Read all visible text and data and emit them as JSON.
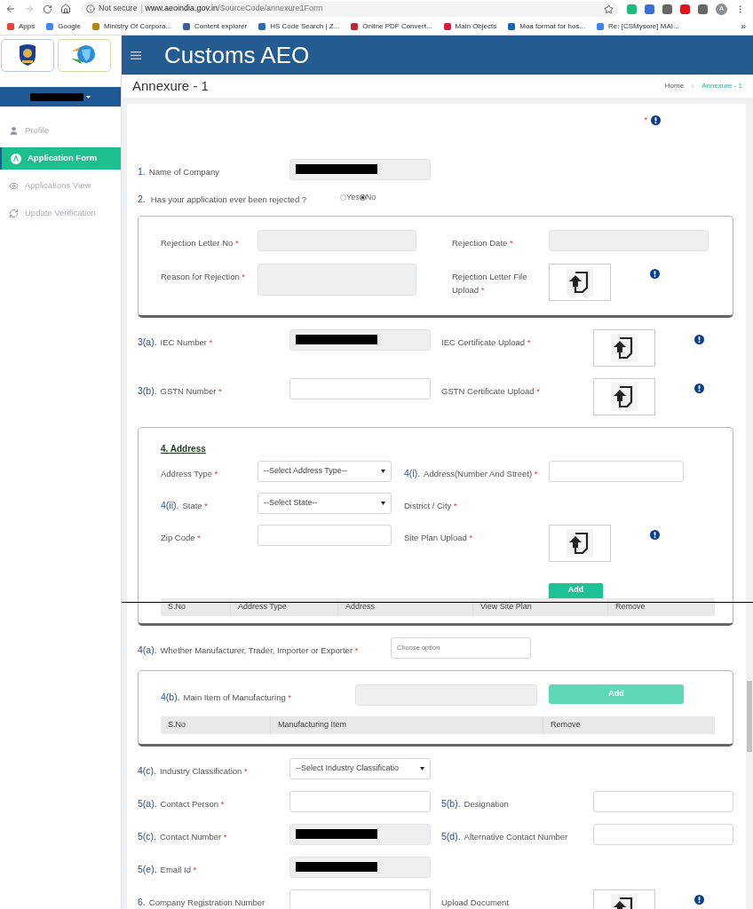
{
  "browser": {
    "security": "Not secure",
    "url_host": "www.aeoindia.gov.in",
    "url_path": "/SourceCode/annexure1Form",
    "profile_initial": "A",
    "more": "»",
    "bookmarks": [
      {
        "label": "Apps",
        "color": "#ea4335"
      },
      {
        "label": "Google",
        "color": "#4285f4"
      },
      {
        "label": "Ministry Of Corpora...",
        "color": "#b8860b"
      },
      {
        "label": "Content explorer",
        "color": "#3b5ba5"
      },
      {
        "label": "HS Code Search | Z...",
        "color": "#2b6cb0"
      },
      {
        "label": "Online PDF Convert...",
        "color": "#c0262d"
      },
      {
        "label": "Main Objects",
        "color": "#d81b3c"
      },
      {
        "label": "Moa format for hos...",
        "color": "#1565c0"
      },
      {
        "label": "Re: [CSMysore] MAI...",
        "color": "#3b82f6"
      }
    ]
  },
  "header": {
    "title": "Customs AEO"
  },
  "sidebar": {
    "user_redacted": true,
    "items": [
      {
        "label": "Profile",
        "kind": "user",
        "selected": false
      },
      {
        "label": "Application Form",
        "kind": "badge",
        "selected": true
      },
      {
        "label": "Applications View",
        "kind": "eye",
        "selected": false
      },
      {
        "label": "Update Verification",
        "kind": "refresh",
        "selected": false
      }
    ]
  },
  "page": {
    "title": "Annexure - 1",
    "breadcrumb": [
      {
        "label": "Home",
        "selected": false
      },
      {
        "label": "Annexure - 1",
        "selected": true
      }
    ]
  },
  "form": {
    "legend": {
      "mark": "*"
    },
    "sections": [
      {
        "kind": "row",
        "cells": [
          {
            "number": "1.",
            "label": "Name of Company",
            "kind": "readonly",
            "redacted": true
          }
        ]
      },
      {
        "kind": "radio",
        "number": "2.",
        "label": "Has your application ever been rejected ?",
        "options": [
          {
            "label": "Yes",
            "selected": false
          },
          {
            "label": "No",
            "selected": true
          }
        ]
      },
      {
        "kind": "box",
        "rows": [
          [
            {
              "label": "Rejection Letter No",
              "mark": "*",
              "kind": "readonly"
            },
            {
              "label": "Rejection Date",
              "mark": "*",
              "kind": "readonly"
            }
          ],
          [
            {
              "label": "Reason for Rejection",
              "mark": "*",
              "kind": "textarea"
            },
            {
              "label": "Rejection Letter File Upload",
              "mark": "*",
              "kind": "upload",
              "info": true
            }
          ]
        ]
      },
      {
        "kind": "row",
        "cells": [
          {
            "number": "3(a).",
            "label": "IEC Number",
            "mark": "*",
            "kind": "readonly",
            "redacted": true
          },
          {
            "label": "IEC Certificate Upload",
            "mark": "*",
            "kind": "upload",
            "info": true
          }
        ]
      },
      {
        "kind": "row",
        "cells": [
          {
            "number": "3(b).",
            "label": "GSTN Number",
            "mark": "*",
            "kind": "text"
          },
          {
            "label": "GSTN Certificate Upload",
            "mark": "*",
            "kind": "upload",
            "info": true
          }
        ]
      },
      {
        "kind": "address",
        "title": "4. Address",
        "field_rows": [
          [
            {
              "label": "Address Type",
              "mark": "*",
              "kind": "select",
              "value": "--Select Address Type--"
            },
            {
              "number": "4(i).",
              "label": "Address(Number And Street)",
              "mark": "*",
              "kind": "text"
            }
          ],
          [
            {
              "number": "4(ii).",
              "label": "State",
              "mark": "*",
              "kind": "select",
              "value": "--Select State--"
            },
            {
              "label": "District / City",
              "mark": "*",
              "kind": "none"
            }
          ],
          [
            {
              "label": "Zip Code",
              "mark": "*",
              "kind": "text"
            },
            {
              "label": "Site Plan Upload",
              "mark": "*",
              "kind": "upload",
              "info": true
            }
          ]
        ],
        "button": "Add",
        "columns": [
          "S.No",
          "Address Type",
          "Address",
          "View Site Plan",
          "Remove"
        ]
      },
      {
        "kind": "wide",
        "cells": [
          {
            "number": "4(a).",
            "label": "Whether Manufacturer, Trader, Importer or Exporter",
            "mark": "*",
            "kind": "choice",
            "placeholder": "Choose option"
          }
        ]
      },
      {
        "kind": "items",
        "button": "Add",
        "field": {
          "number": "4(b).",
          "label": "Main Item of Manufacturing",
          "mark": "*",
          "kind": "readonly"
        },
        "columns": [
          "S.No",
          "Manufacturing Item",
          "Remove"
        ]
      },
      {
        "kind": "row",
        "cells": [
          {
            "number": "4(c).",
            "label": "Industry Classification",
            "mark": "*",
            "kind": "select",
            "value": "--Select Industry Classificatio"
          }
        ]
      },
      {
        "kind": "row",
        "cells": [
          {
            "number": "5(a).",
            "label": "Contact Person",
            "mark": "*",
            "kind": "text"
          },
          {
            "number": "5(b).",
            "label": "Designation",
            "kind": "text"
          }
        ]
      },
      {
        "kind": "row",
        "cells": [
          {
            "number": "5(c).",
            "label": "Contact Number",
            "mark": "*",
            "kind": "readonly",
            "redacted": true
          },
          {
            "number": "5(d).",
            "label": "Alternative Contact Number",
            "kind": "text"
          }
        ]
      },
      {
        "kind": "row",
        "cells": [
          {
            "number": "5(e).",
            "label": "Email Id",
            "mark": "*",
            "kind": "readonly",
            "redacted": true
          }
        ]
      },
      {
        "kind": "row",
        "cells": [
          {
            "number": "6.",
            "label": "Company Registration Number",
            "kind": "text"
          },
          {
            "label": "Upload Document",
            "kind": "upload",
            "info": true
          }
        ]
      }
    ]
  }
}
